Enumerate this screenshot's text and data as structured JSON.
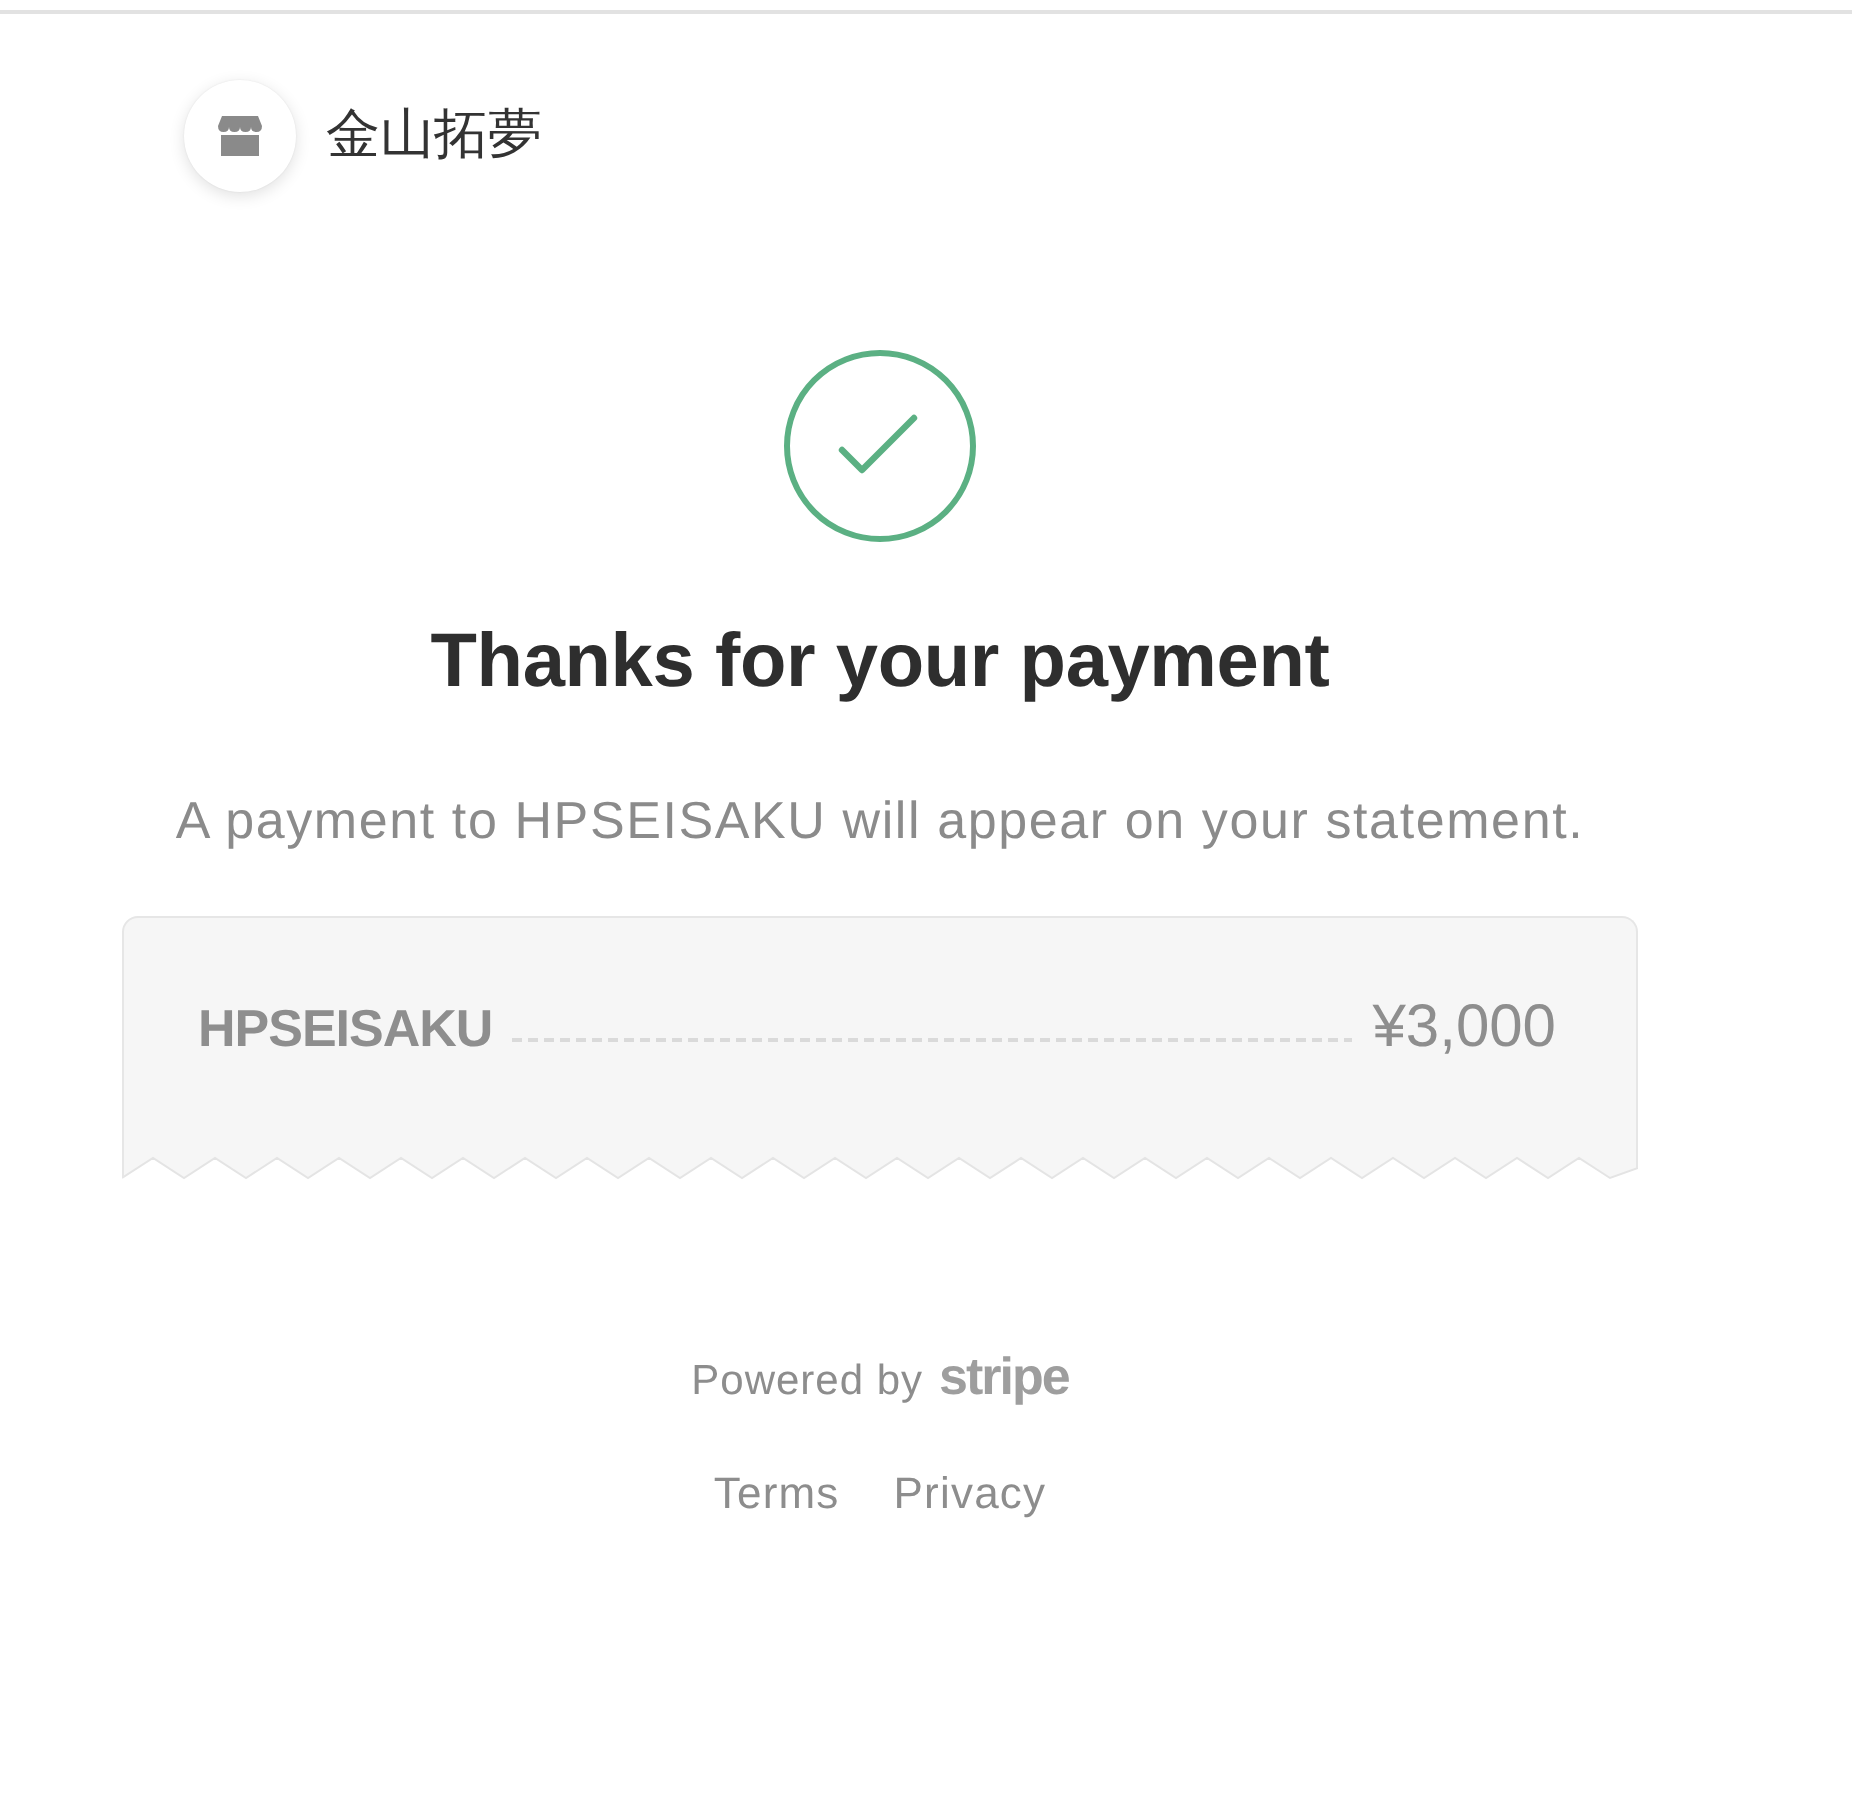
{
  "merchant": {
    "name": "金山拓夢"
  },
  "status": {
    "kind": "success",
    "title": "Thanks for your payment",
    "message": "A payment to HPSEISAKU will appear on your statement."
  },
  "receipt": {
    "items": [
      {
        "label": "HPSEISAKU",
        "amount": "¥3,000"
      }
    ]
  },
  "footer": {
    "powered_by": "Powered by",
    "brand": "stripe",
    "links": [
      "Terms",
      "Privacy"
    ]
  }
}
